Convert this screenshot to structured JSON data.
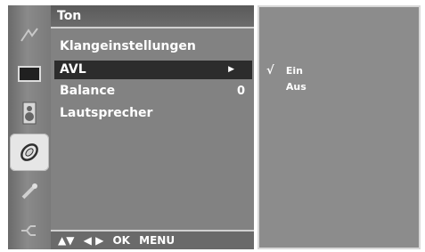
{
  "icons": [
    {
      "name": "picture-icon"
    },
    {
      "name": "screen-icon"
    },
    {
      "name": "speaker-icon"
    },
    {
      "name": "time-icon"
    },
    {
      "name": "option-icon"
    },
    {
      "name": "setup-icon"
    }
  ],
  "menu": {
    "title": "Ton",
    "items": [
      {
        "label": "Klangeinstellungen",
        "value": "",
        "arrow": false
      },
      {
        "label": "AVL",
        "value": "",
        "arrow": true
      },
      {
        "label": "Balance",
        "value": "0",
        "arrow": false
      },
      {
        "label": "Lautsprecher",
        "value": "",
        "arrow": false
      }
    ],
    "selected_index": 1,
    "footer": {
      "updown": "▲▼",
      "leftright": "◀ ▶",
      "ok": "OK",
      "menu": "MENU"
    }
  },
  "submenu": {
    "options": [
      {
        "label": "Ein",
        "checked": true,
        "check_mark": "√"
      },
      {
        "label": "Aus",
        "checked": false,
        "check_mark": ""
      }
    ]
  }
}
